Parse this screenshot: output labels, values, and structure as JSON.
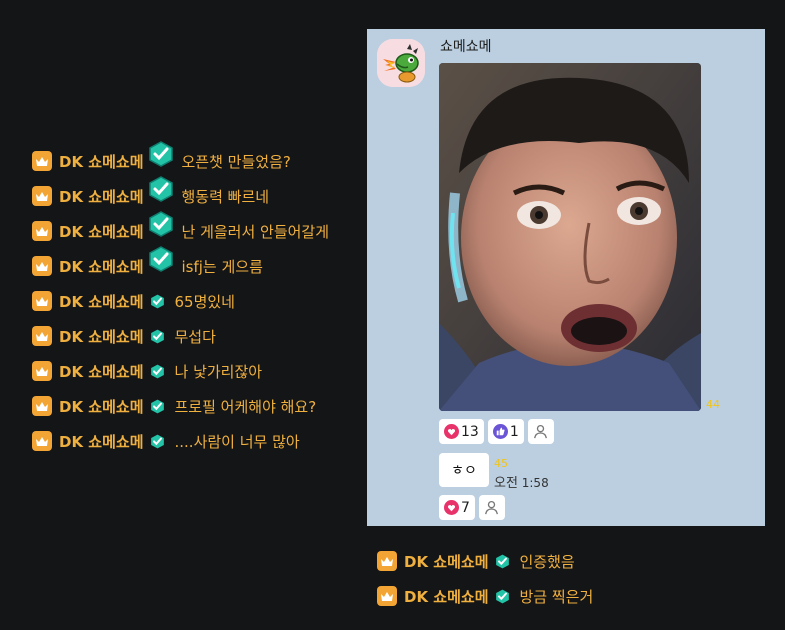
{
  "chat_left": [
    {
      "username": "DK 쇼메쇼메",
      "message": "오픈챗 만들었음?",
      "badge": "large"
    },
    {
      "username": "DK 쇼메쇼메",
      "message": "행동력 빠르네",
      "badge": "large"
    },
    {
      "username": "DK 쇼메쇼메",
      "message": "난 게을러서 안들어갈게",
      "badge": "large"
    },
    {
      "username": "DK 쇼메쇼메",
      "message": "isfj는 게으름",
      "badge": "large"
    },
    {
      "username": "DK 쇼메쇼메",
      "message": "65명있네",
      "badge": "small"
    },
    {
      "username": "DK 쇼메쇼메",
      "message": "무섭다",
      "badge": "small"
    },
    {
      "username": "DK 쇼메쇼메",
      "message": "나 낯가리잖아",
      "badge": "small"
    },
    {
      "username": "DK 쇼메쇼메",
      "message": "프로필 어케해야 해요?",
      "badge": "small"
    },
    {
      "username": "DK 쇼메쇼메",
      "message": "....사람이 너무 많아",
      "badge": "small"
    }
  ],
  "kakao": {
    "sender": "쇼메쇼메",
    "photo_unread": "44",
    "photo_reactions": [
      {
        "icon": "heart-icon",
        "count": "13"
      },
      {
        "icon": "thumbs-up-icon",
        "count": "1"
      },
      {
        "icon": "person-icon",
        "count": ""
      }
    ],
    "text_message": "ㅎㅇ",
    "text_unread": "45",
    "time_ampm": "오전",
    "time": "1:58",
    "text_reactions": [
      {
        "icon": "heart-icon",
        "count": "7"
      },
      {
        "icon": "person-icon",
        "count": ""
      }
    ],
    "colors": {
      "panel_bg": "#bccfe1",
      "heart": "#e8336a",
      "thumb": "#6b55d6",
      "unread": "#f0c419"
    }
  },
  "chat_bottom": [
    {
      "username": "DK 쇼메쇼메",
      "message": "인증했음"
    },
    {
      "username": "DK 쇼메쇼메",
      "message": "방금 찍은거"
    }
  ],
  "colors": {
    "background": "#141517",
    "username": "#f0b040",
    "crown_bg": "#f2a534",
    "badge": "#1fc0a5"
  }
}
